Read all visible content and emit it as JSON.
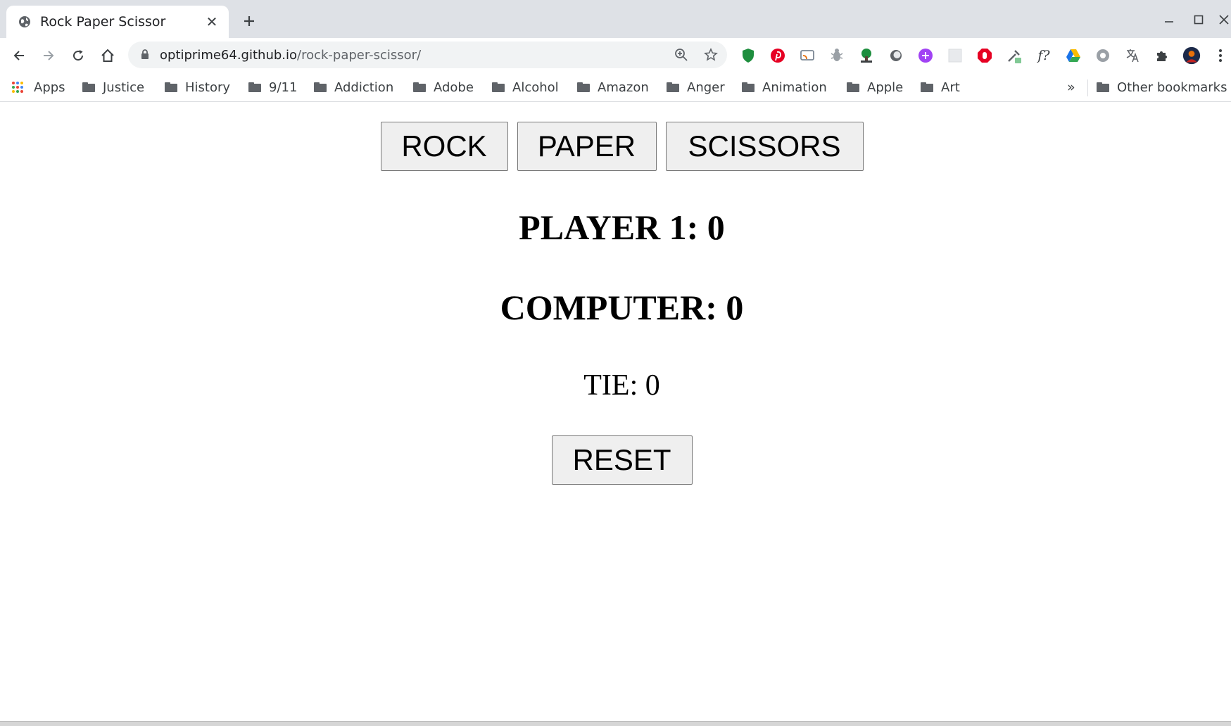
{
  "browser": {
    "tab": {
      "title": "Rock Paper Scissor",
      "favicon": "globe-icon",
      "close_glyph": "✕"
    },
    "new_tab_glyph": "+",
    "address": {
      "host": "optiprime64.github.io",
      "path": "/rock-paper-scissor/"
    },
    "bookmarks": [
      {
        "label": "Apps",
        "icon": "apps-grid-icon"
      },
      {
        "label": "Justice",
        "icon": "folder-icon"
      },
      {
        "label": "History",
        "icon": "folder-icon"
      },
      {
        "label": "9/11",
        "icon": "folder-icon"
      },
      {
        "label": "Addiction",
        "icon": "folder-icon"
      },
      {
        "label": "Adobe",
        "icon": "folder-icon"
      },
      {
        "label": "Alcohol",
        "icon": "folder-icon"
      },
      {
        "label": "Amazon",
        "icon": "folder-icon"
      },
      {
        "label": "Anger",
        "icon": "folder-icon"
      },
      {
        "label": "Animation",
        "icon": "folder-icon"
      },
      {
        "label": "Apple",
        "icon": "folder-icon"
      },
      {
        "label": "Art",
        "icon": "folder-icon"
      }
    ],
    "bookmarks_overflow": "»",
    "other_bookmarks": "Other bookmarks"
  },
  "game": {
    "choices": {
      "rock": "ROCK",
      "paper": "PAPER",
      "scissors": "SCISSORS"
    },
    "player_score": "PLAYER 1: 0",
    "computer_score": "COMPUTER: 0",
    "tie_score": "TIE: 0",
    "reset_label": "RESET"
  },
  "colors": {
    "tab_strip": "#dee1e6",
    "omnibox": "#f1f3f4",
    "button_bg": "#efefef",
    "button_border": "#767676"
  }
}
